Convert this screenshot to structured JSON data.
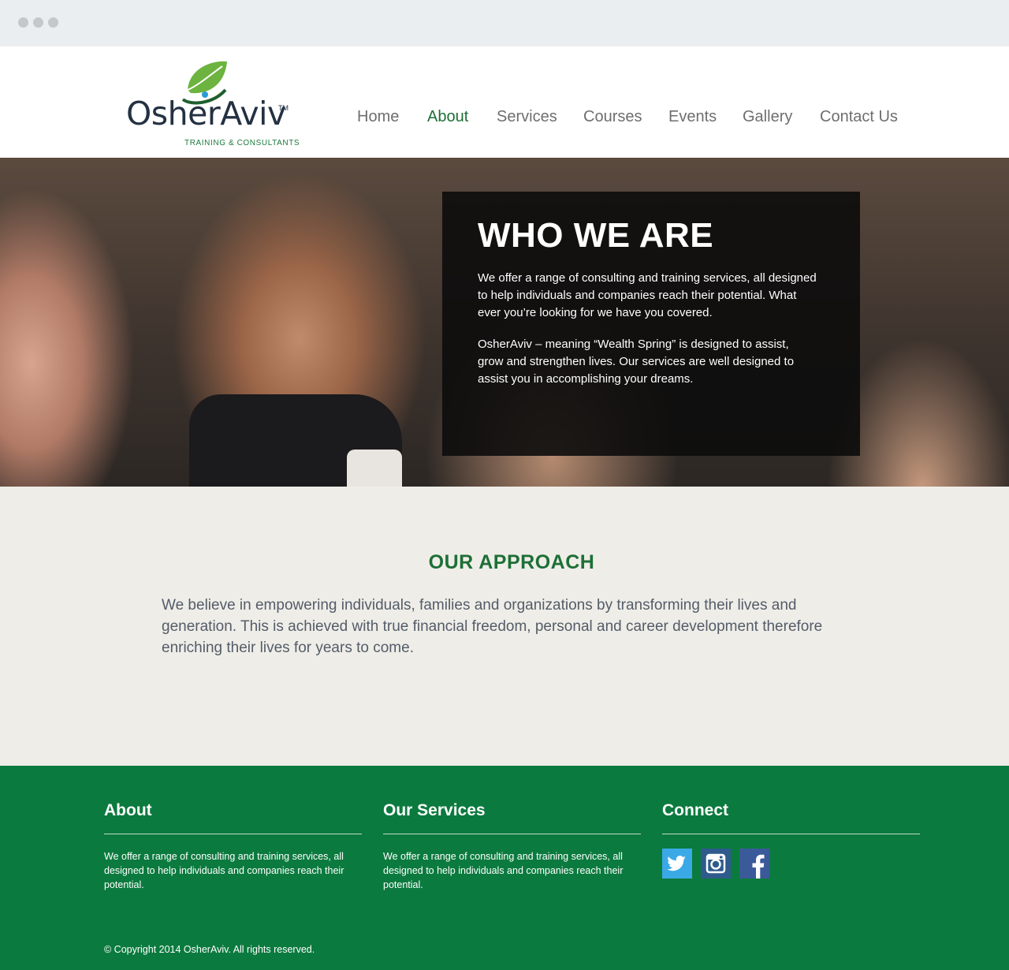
{
  "brand": {
    "name": "OsherAviv",
    "trademark": "TM",
    "tagline": "TRAINING & CONSULTANTS",
    "leaf_color": "#5fa533",
    "accent_color": "#1d6f36"
  },
  "nav": {
    "items": [
      {
        "label": "Home"
      },
      {
        "label": "About",
        "active": true
      },
      {
        "label": "Services"
      },
      {
        "label": "Courses"
      },
      {
        "label": "Events"
      },
      {
        "label": "Gallery"
      },
      {
        "label": "Contact Us"
      }
    ]
  },
  "hero": {
    "title": "WHO WE ARE",
    "paragraph1": "We offer a range of consulting and training services, all designed to help individuals and companies reach their potential. What ever you’re looking for we have you covered.",
    "paragraph2": "OsherAviv – meaning “Wealth Spring” is designed to assist, grow and strengthen lives. Our services are well designed to assist you in accomplishing your dreams."
  },
  "approach": {
    "title": "OUR APPROACH",
    "text": "We believe in empowering individuals, families and organizations by transforming their lives and generation. This is achieved with true financial freedom, personal and career development therefore enriching their lives for years to come."
  },
  "footer": {
    "background": "#0b7a3e",
    "about": {
      "heading": "About",
      "text": "We offer a range of consulting and training services, all designed to help individuals and companies reach their potential."
    },
    "services": {
      "heading": "Our Services",
      "text": "We offer a range of consulting and training services, all designed to help individuals and companies reach their potential."
    },
    "connect": {
      "heading": "Connect",
      "icons": [
        "twitter-icon",
        "instagram-icon",
        "facebook-icon"
      ]
    },
    "copyright": "© Copyright 2014 OsherAviv. All rights reserved."
  }
}
